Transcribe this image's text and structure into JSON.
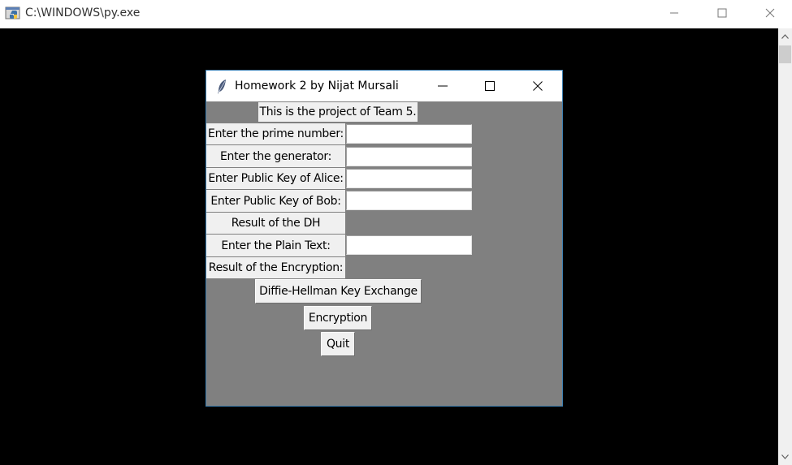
{
  "console": {
    "title": "C:\\WINDOWS\\py.exe"
  },
  "tk": {
    "title": "Homework 2 by Nijat Mursali",
    "header": "This is the project of Team 5.",
    "fields": [
      {
        "label": "Enter the prime number:",
        "value": ""
      },
      {
        "label": "Enter the generator:",
        "value": ""
      },
      {
        "label": "Enter Public Key of Alice:",
        "value": ""
      },
      {
        "label": "Enter Public Key of Bob:",
        "value": ""
      }
    ],
    "result_dh_label": "Result of the DH",
    "plain_text": {
      "label": "Enter the Plain Text:",
      "value": ""
    },
    "result_enc_label": "Result of the Encryption:",
    "buttons": {
      "dh": "Diffie-Hellman Key Exchange",
      "encryption": "Encryption",
      "quit": "Quit"
    }
  },
  "colors": {
    "tk_background": "#808080",
    "widget_background": "#f0f0f0",
    "console_background": "#000000"
  },
  "icons": [
    "python-console-icon",
    "minimize-icon",
    "maximize-icon",
    "close-icon",
    "tk-feather-icon",
    "scroll-up-icon",
    "scroll-down-icon"
  ]
}
